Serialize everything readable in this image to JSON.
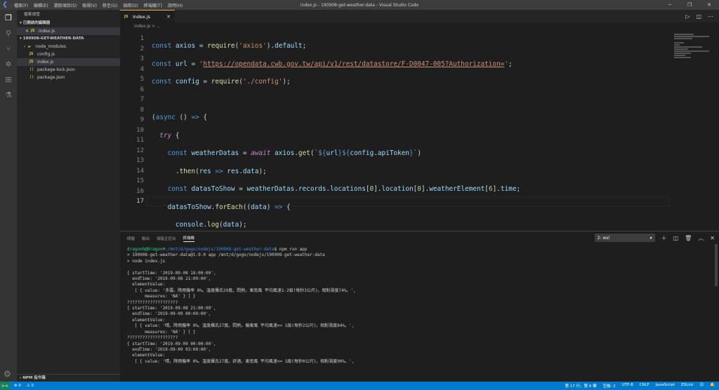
{
  "window": {
    "title": "index.js - 190908-get-weather-data - Visual Studio Code",
    "menu": [
      "檔案(F)",
      "編輯(E)",
      "選取項目(S)",
      "檢視(V)",
      "移至(G)",
      "偵錯(D)",
      "終端機(T)",
      "說明(H)"
    ]
  },
  "sidebar": {
    "header": "檔案總管",
    "open_editors_label": "已開啟的編輯器",
    "open_file": "index.js",
    "project_label": "190908-GET-WEATHER-DATA",
    "items": [
      {
        "label": "node_modules",
        "type": "folder"
      },
      {
        "label": "config.js",
        "type": "js"
      },
      {
        "label": "index.js",
        "type": "js"
      },
      {
        "label": "package-lock.json",
        "type": "json"
      },
      {
        "label": "package.json",
        "type": "json"
      }
    ],
    "npm_label": "NPM 指令碼"
  },
  "editor": {
    "tab_label": "index.js",
    "breadcrumb": "index.js > ...",
    "lines": [
      "1",
      "2",
      "3",
      "4",
      "5",
      "6",
      "7",
      "8",
      "9",
      "10",
      "11",
      "12",
      "13",
      "14",
      "15",
      "16",
      "17"
    ],
    "current_line": "17"
  },
  "panel": {
    "tabs": [
      "問題",
      "輸出",
      "偵錯主控台",
      "終端機"
    ],
    "active_tab": "終端機",
    "terminal_select": "2: wsl",
    "prompt_user": "dragonh@DragonH",
    "prompt_path": ":/mnt/d/gogo/nodejs/190908-get-weather-data",
    "prompt_cmd": "$ npm run app",
    "output": "\n> 190908-get-weather-data@1.0.0 app /mnt/d/gogo/nodejs/190908-get-weather-data\n> node index.js\n\n{ startTime: '2019-09-08 18:00:00',\n  endTime: '2019-09-08 21:00:00',\n  elementValue:\n   [ { value: '多雲。降雨機率 0%。溫度攝氏29度。悶熱。東南風 平均風速1-2級(每秒3公尺)。相對濕度74%。',\n       measures: 'NA' } ] }\n????????????????????\n{ startTime: '2019-09-08 21:00:00',\n  endTime: '2019-09-09 00:00:00',\n  elementValue:\n   [ { value: '晴。降雨機率 0%。溫度攝氏27度。悶熱。偏東風 平均風速<= 1級(每秒2公尺)。相對濕度84%。',\n       measures: 'NA' } ] }\n????????????????????\n{ startTime: '2019-09-09 00:00:00',\n  endTime: '2019-09-09 03:00:00',\n  elementValue:\n   [ { value: '晴。降雨機率 0%。溫度攝氏27度。舒適。東南風 平均風速<= 1級(每秒0公尺)。相對濕度90%。',"
  },
  "status": {
    "remote": "><",
    "errors": "⊗ 0",
    "warnings": "⚠ 0",
    "cursor": "第 17 行，第 6 欄",
    "spaces": "空格: 2",
    "encoding": "UTF-8",
    "eol": "CRLF",
    "language": "JavaScript",
    "eslint": "ESLint"
  }
}
